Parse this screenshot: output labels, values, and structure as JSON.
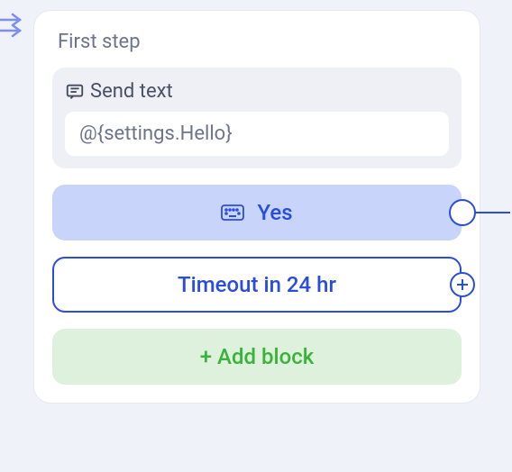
{
  "card": {
    "title": "First step",
    "send_block": {
      "label": "Send text",
      "value": "@{settings.Hello}"
    },
    "options": {
      "yes_label": "Yes",
      "timeout_label": "Timeout in 24 hr"
    },
    "add_block_label": "+ Add block"
  }
}
